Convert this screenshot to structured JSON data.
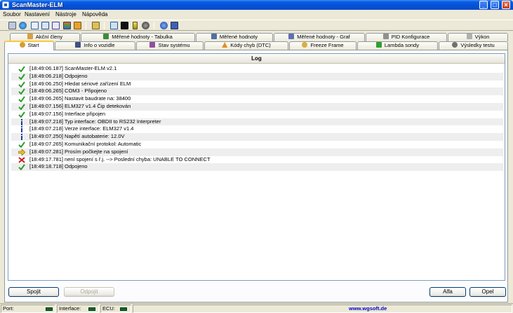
{
  "window": {
    "title": "ScanMaster-ELM",
    "minimize": "_",
    "maximize": "□",
    "close": "×"
  },
  "menu": [
    "Soubor",
    "Nastavení",
    "Nástroje",
    "Nápověda"
  ],
  "toolbar_icons": [
    "connect-icon",
    "globe-icon",
    "table-icon",
    "grid-icon",
    "dtc-icon",
    "chart-icon",
    "profile-icon",
    "settings-icon",
    "monitor-icon",
    "terminal-icon",
    "battery-icon",
    "record-icon",
    "info-icon",
    "save-icon"
  ],
  "tabs_row1": [
    {
      "label": "Akční členy",
      "icon": "actuator-icon",
      "color": "#d8a040"
    },
    {
      "label": "Měřené hodnoty - Tabulka",
      "icon": "table-icon",
      "color": "#3c8c3c"
    },
    {
      "label": "Měřené hodnoty",
      "icon": "gauge-icon",
      "color": "#5070a0"
    },
    {
      "label": "Měřené hodnoty - Graf",
      "icon": "graph-icon",
      "color": "#6070b0"
    },
    {
      "label": "PID Konfigurace",
      "icon": "config-icon",
      "color": "#909090"
    },
    {
      "label": "Výkon",
      "icon": "power-icon",
      "color": "#b0b0b0"
    }
  ],
  "tabs_row2": [
    {
      "label": "Start",
      "icon": "start-icon",
      "color": "#d0a030",
      "active": true
    },
    {
      "label": "Info o vozidle",
      "icon": "car-info-icon",
      "color": "#405080"
    },
    {
      "label": "Stav systému",
      "icon": "system-icon",
      "color": "#9050a0"
    },
    {
      "label": "Kódy chyb (DTC)",
      "icon": "warning-icon",
      "color": "#e09020"
    },
    {
      "label": "Freeze Frame",
      "icon": "freeze-icon",
      "color": "#d8b040"
    },
    {
      "label": "Lambda sondy",
      "icon": "lambda-icon",
      "color": "#30a030"
    },
    {
      "label": "Výsledky testu",
      "icon": "test-icon",
      "color": "#707070"
    }
  ],
  "log": {
    "title": "Log",
    "entries": [
      {
        "type": "ok",
        "icon": "check-icon",
        "text": "[18:49:06.187] ScanMaster-ELM v2.1"
      },
      {
        "type": "ok",
        "icon": "check-icon",
        "text": "[18:49:06.218] Odpojeno"
      },
      {
        "type": "ok",
        "icon": "check-icon",
        "text": "[18:49:06.250] Hledat sériové zařízení ELM"
      },
      {
        "type": "ok",
        "icon": "check-icon",
        "text": "[18:49:06.265] COM3 - Připojeno"
      },
      {
        "type": "ok",
        "icon": "check-icon",
        "text": "[18:49:06.265] Nastavit baudrate na: 38400"
      },
      {
        "type": "ok",
        "icon": "check-icon",
        "text": "[18:49:07.156] ELM327 v1.4 Čip detekován"
      },
      {
        "type": "ok",
        "icon": "check-icon",
        "text": "[18:49:07.156] Interface připojen"
      },
      {
        "type": "info",
        "icon": "info-icon",
        "text": "[18:49:07.218] Typ interface: OBDII to RS232 Interpreter"
      },
      {
        "type": "info",
        "icon": "info-icon",
        "text": "[18:49:07.218]  Verze interface: ELM327 v1.4"
      },
      {
        "type": "info",
        "icon": "info-icon",
        "text": "[18:49:07.250] Napětí autobaterie: 12.0V"
      },
      {
        "type": "ok",
        "icon": "check-icon",
        "text": "[18:49:07.265] Komunikační protokol: Automatic"
      },
      {
        "type": "arrow",
        "icon": "arrow-right-icon",
        "text": "[18:49:07.281] Prosím počkejte na spojení"
      },
      {
        "type": "error",
        "icon": "error-x-icon",
        "text": "[18:49:17.781] není spojení s ř.j. --> Poslední chyba: UNABLE TO CONNECT"
      },
      {
        "type": "ok",
        "icon": "check-icon",
        "text": "[18:49:18.718] Odpojeno"
      }
    ]
  },
  "buttons": {
    "connect": "Spojit",
    "disconnect": "Odpojit",
    "alpha": "Alfa",
    "close": "Opel"
  },
  "status": {
    "port_label": "Port:",
    "interface_label": "Interface:",
    "ecu_label": "ECU:",
    "website": "www.wgsoft.de",
    "led_color": "#0a6e0a"
  },
  "colors": {
    "titlebar": "#0550d8",
    "check": "#2e9e2e",
    "info": "#1c3c9c",
    "error": "#c81e1e",
    "arrow": "#e8c020"
  }
}
